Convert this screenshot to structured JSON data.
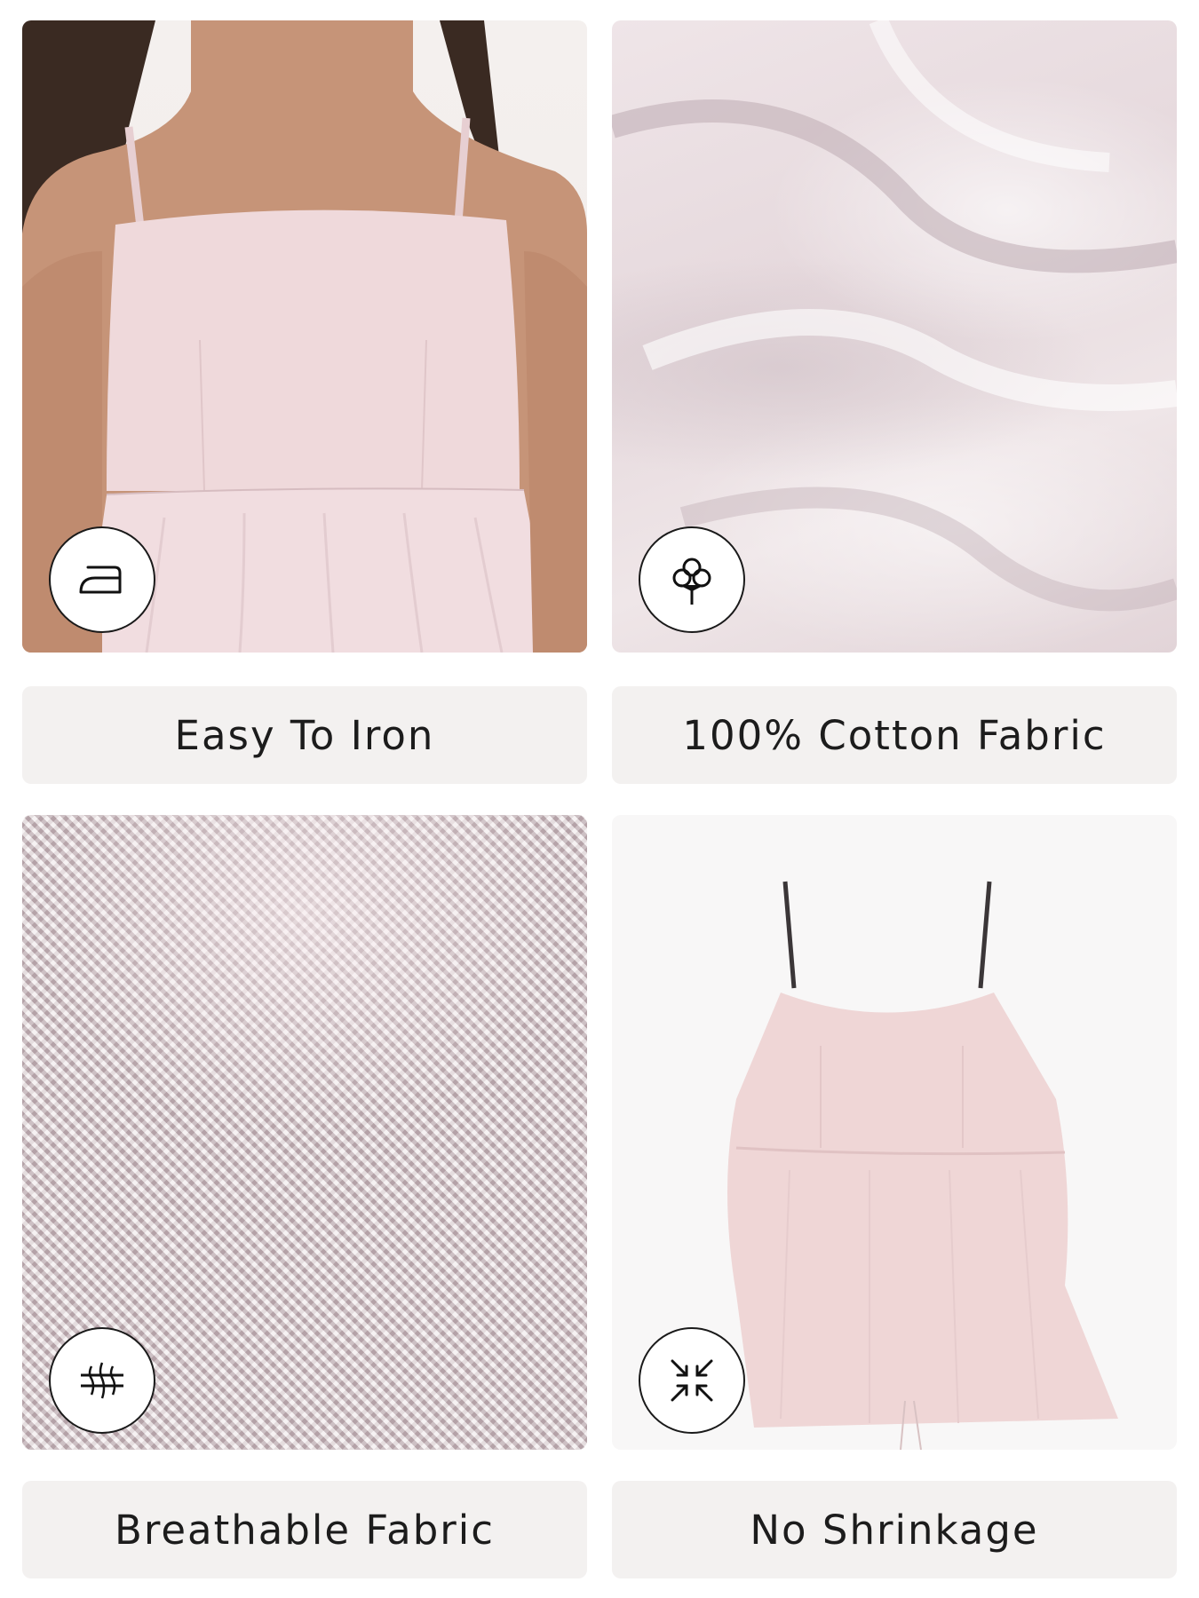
{
  "features": [
    {
      "label": "Easy To Iron",
      "icon": "iron-icon",
      "photo": "model-wearing-pink-cami-top"
    },
    {
      "label": "100% Cotton Fabric",
      "icon": "cotton-flower-icon",
      "photo": "pink-fabric-drape"
    },
    {
      "label": "Breathable Fabric",
      "icon": "breathable-fabric-icon",
      "photo": "pink-fabric-weave-closeup"
    },
    {
      "label": "No Shrinkage",
      "icon": "no-shrinkage-arrows-icon",
      "photo": "pink-cami-top-flat-lay"
    }
  ],
  "colors": {
    "label_background": "#f3f1f0",
    "label_text": "#1c1c1c",
    "garment_pink": "#efd9db",
    "skin": "#c69478",
    "hair": "#3a2a22"
  }
}
